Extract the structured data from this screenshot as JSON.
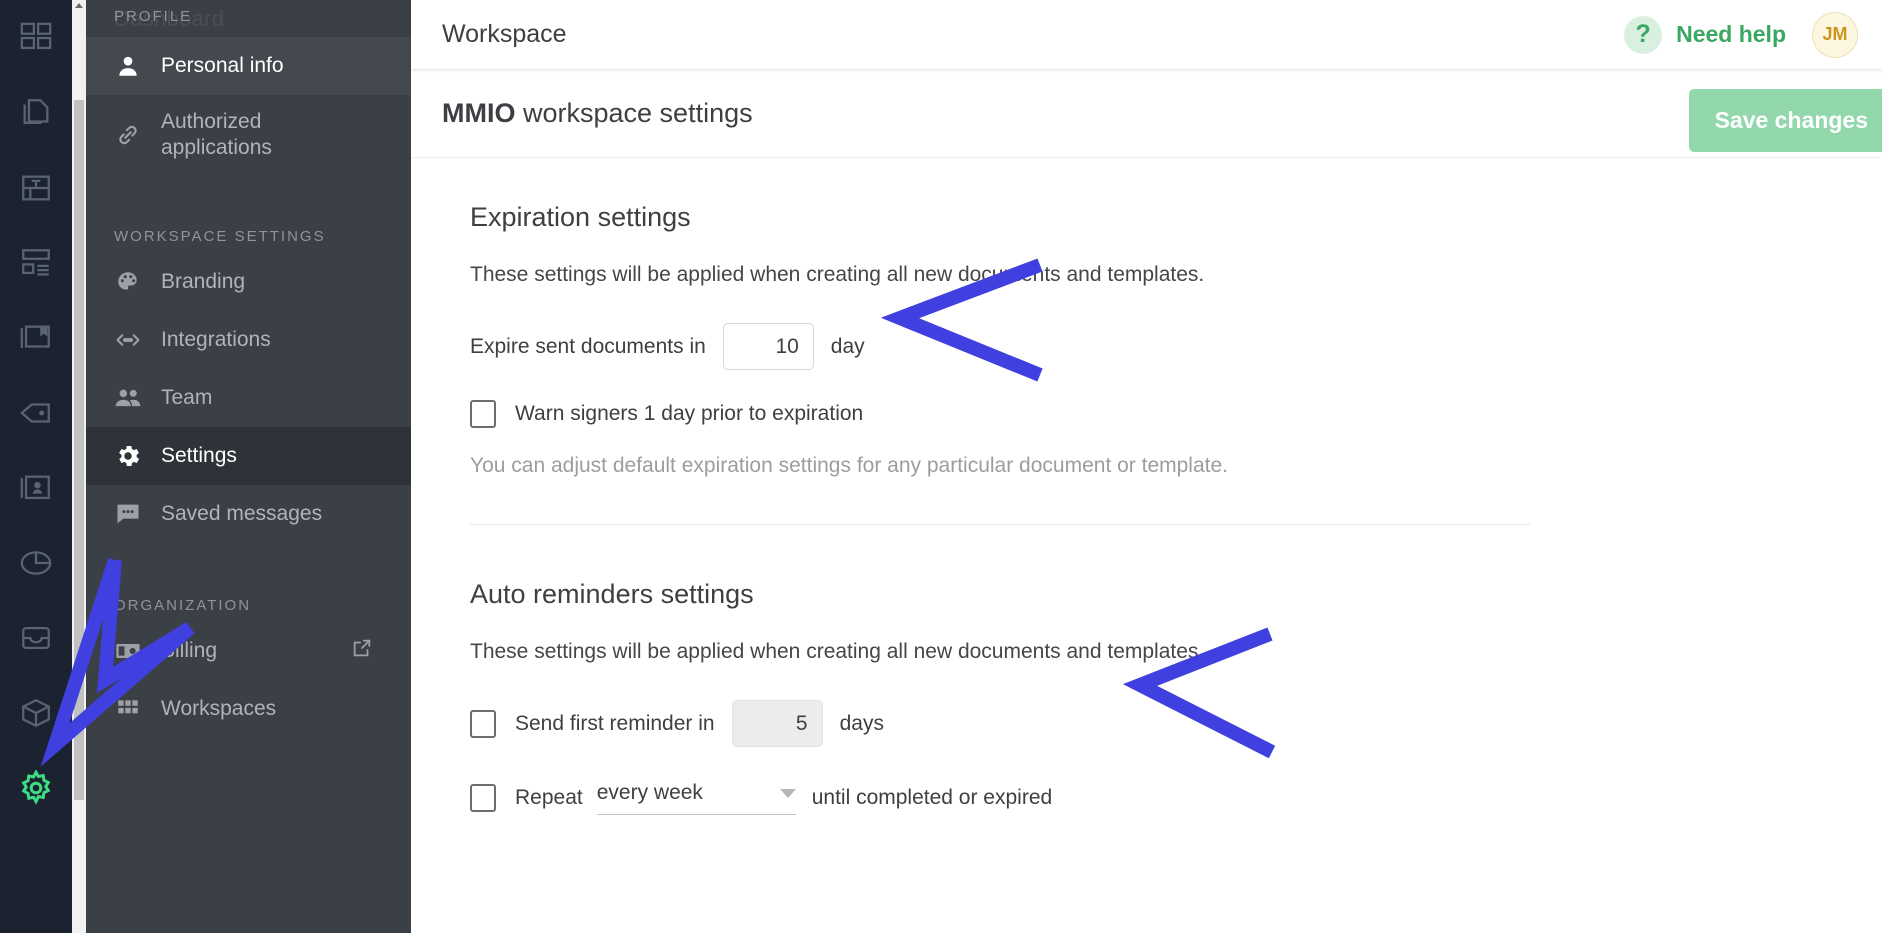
{
  "icon_rail": {
    "items": [
      {
        "name": "dashboard-grid-icon",
        "label": "Dashboard"
      },
      {
        "name": "documents-icon",
        "label": "Documents"
      },
      {
        "name": "templates-icon",
        "label": "Templates"
      },
      {
        "name": "forms-icon",
        "label": "Forms"
      },
      {
        "name": "library-icon",
        "label": "Library"
      },
      {
        "name": "tag-icon",
        "label": "Tags"
      },
      {
        "name": "contacts-icon",
        "label": "Contacts"
      },
      {
        "name": "reports-pie-icon",
        "label": "Reports"
      },
      {
        "name": "inbox-icon",
        "label": "Inbox"
      },
      {
        "name": "box-icon",
        "label": "Integrations"
      },
      {
        "name": "settings-gear-icon",
        "label": "Settings"
      }
    ]
  },
  "nav": {
    "ghost_label": "Dashboard",
    "sections": [
      {
        "title": "PROFILE",
        "items": [
          {
            "label": "Personal info",
            "icon": "person-icon",
            "state": "highlighted"
          },
          {
            "label": "Authorized applications",
            "icon": "link-icon",
            "state": "normal"
          }
        ]
      },
      {
        "title": "WORKSPACE SETTINGS",
        "items": [
          {
            "label": "Branding",
            "icon": "palette-icon",
            "state": "normal"
          },
          {
            "label": "Integrations",
            "icon": "code-arrows-icon",
            "state": "normal"
          },
          {
            "label": "Team",
            "icon": "people-icon",
            "state": "normal"
          },
          {
            "label": "Settings",
            "icon": "gear-icon",
            "state": "active"
          },
          {
            "label": "Saved messages",
            "icon": "chat-dots-icon",
            "state": "normal"
          }
        ]
      },
      {
        "title": "ORGANIZATION",
        "items": [
          {
            "label": "Billing",
            "icon": "billing-card-icon",
            "state": "normal",
            "external": true
          },
          {
            "label": "Workspaces",
            "icon": "grid-dots-icon",
            "state": "normal"
          }
        ]
      }
    ]
  },
  "topbar": {
    "workspace_title": "Workspace",
    "help_label": "Need help",
    "help_icon": "question-mark-icon",
    "avatar_initials": "JM"
  },
  "subbar": {
    "workspace_name": "MMIO",
    "heading_rest": " workspace settings",
    "save_label": "Save changes"
  },
  "expiration": {
    "title": "Expiration settings",
    "description": "These settings will be applied when creating all new documents and templates.",
    "expire_label": "Expire sent documents in",
    "expire_value": "10",
    "expire_unit": "day",
    "warn_label": "Warn signers 1 day prior to expiration",
    "warn_checked": false,
    "hint": "You can adjust default expiration settings for any particular document or template."
  },
  "reminders": {
    "title": "Auto reminders settings",
    "description": "These settings will be applied when creating all new documents and templates.",
    "first_label": "Send first reminder in",
    "first_value": "5",
    "first_unit": "days",
    "first_checked": false,
    "repeat_label": "Repeat",
    "repeat_value": "every week",
    "repeat_suffix": "until completed or expired",
    "repeat_checked": false
  },
  "colors": {
    "accent_green": "#3aa861",
    "save_button": "#93d8ac",
    "rail_background": "#1b2230",
    "nav_background": "#3b3f46",
    "annotation_arrow": "#4040e0"
  }
}
